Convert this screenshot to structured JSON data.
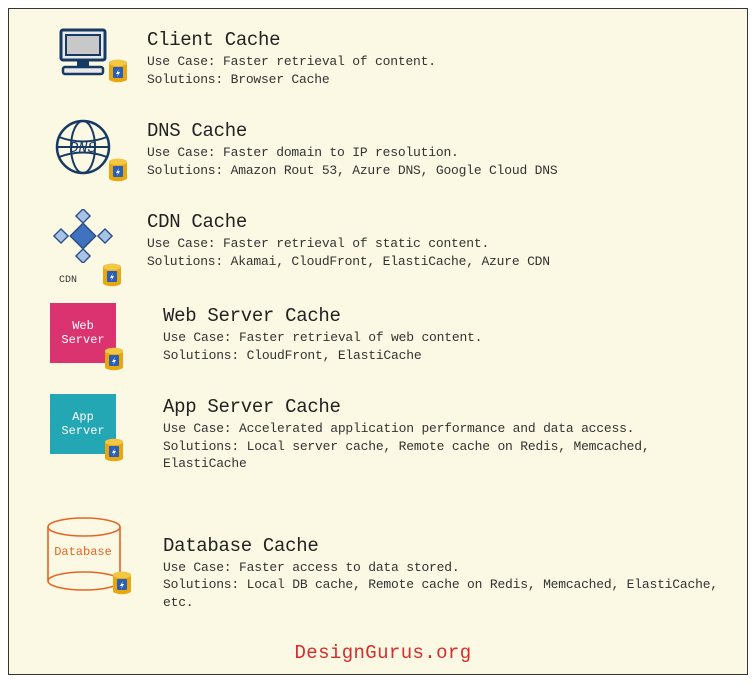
{
  "rows": [
    {
      "title": "Client Cache",
      "usecase": "Use Case: Faster retrieval of content.",
      "solutions": "Solutions: Browser Cache"
    },
    {
      "title": "DNS Cache",
      "usecase": "Use Case: Faster domain to IP resolution.",
      "solutions": "Solutions: Amazon Rout 53, Azure DNS, Google Cloud DNS"
    },
    {
      "title": "CDN Cache",
      "usecase": "Use Case: Faster retrieval of static content.",
      "solutions": "Solutions: Akamai, CloudFront, ElastiCache, Azure CDN"
    },
    {
      "title": "Web Server Cache",
      "usecase": "Use Case: Faster retrieval of web content.",
      "solutions": "Solutions: CloudFront, ElastiCache"
    },
    {
      "title": "App Server Cache",
      "usecase": "Use Case: Accelerated application performance and data access.",
      "solutions": "Solutions: Local server cache, Remote cache on Redis, Memcached, ElastiCache"
    },
    {
      "title": "Database Cache",
      "usecase": "Use Case: Faster access to data stored.",
      "solutions": "Solutions: Local DB cache, Remote cache on Redis, Memcached, ElastiCache, etc."
    }
  ],
  "labels": {
    "dns": "DNS",
    "cdn": "CDN",
    "web": "Web\nServer",
    "app": "App\nServer",
    "db": "Database"
  },
  "footer": "DesignGurus.org"
}
